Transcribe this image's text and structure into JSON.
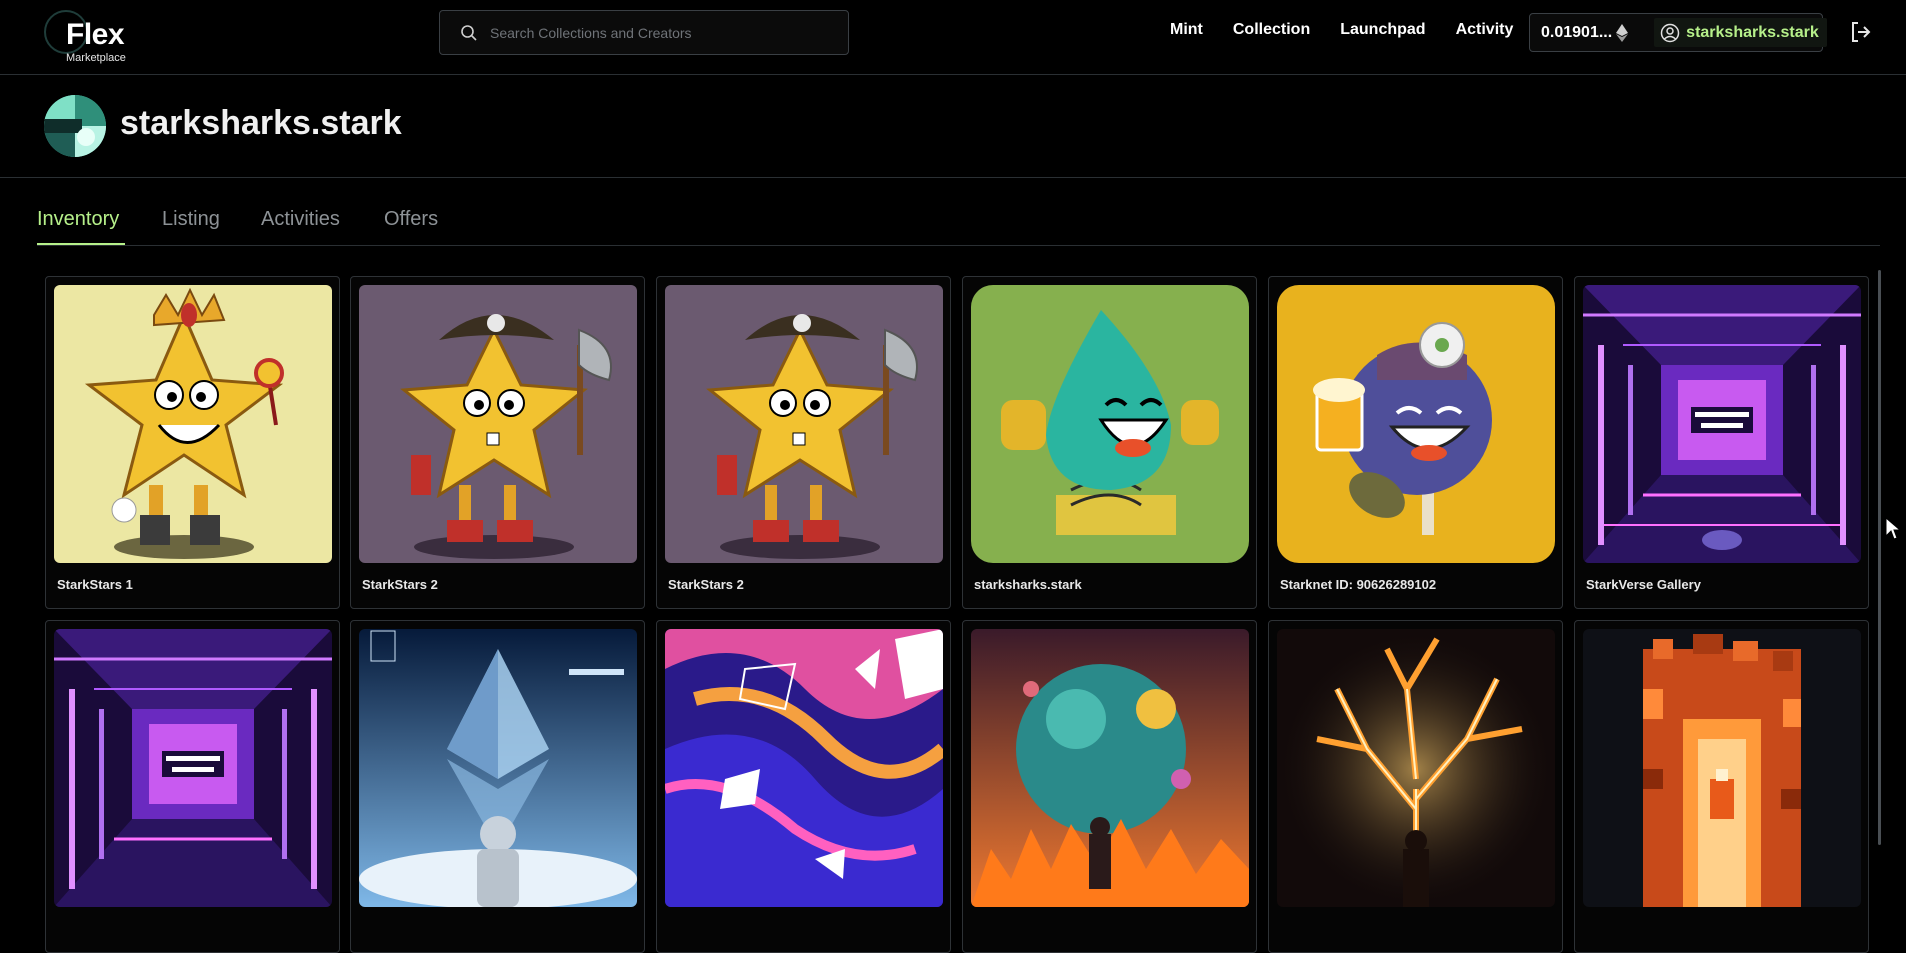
{
  "header": {
    "logo_text": "Flex",
    "logo_sub": "Marketplace",
    "search_placeholder": "Search Collections and Creators",
    "nav": [
      "Mint",
      "Collection",
      "Launchpad",
      "Activity"
    ],
    "balance": "0.01901...",
    "account": "starksharks.stark"
  },
  "profile": {
    "name": "starksharks.stark"
  },
  "tabs": [
    "Inventory",
    "Listing",
    "Activities",
    "Offers"
  ],
  "active_tab": "Inventory",
  "colors": {
    "accent": "#b6f08a",
    "background": "#000000",
    "border": "#2e3236"
  },
  "items": [
    {
      "title": "StarkStars 1",
      "art": "starkstar-king"
    },
    {
      "title": "StarkStars 2",
      "art": "starkstar-pirate"
    },
    {
      "title": "StarkStars 2",
      "art": "starkstar-pirate"
    },
    {
      "title": "starksharks.stark",
      "art": "drop-mascot"
    },
    {
      "title": "Starknet ID: 90626289102",
      "art": "blue-ball-mascot"
    },
    {
      "title": "StarkVerse Gallery",
      "art": "genesis-gallery"
    },
    {
      "title": "",
      "art": "genesis-gallery"
    },
    {
      "title": "",
      "art": "astronaut-ethereum"
    },
    {
      "title": "",
      "art": "abstract-shapes"
    },
    {
      "title": "",
      "art": "planet-fire"
    },
    {
      "title": "",
      "art": "lightning-tree"
    },
    {
      "title": "",
      "art": "lava-portal"
    }
  ]
}
